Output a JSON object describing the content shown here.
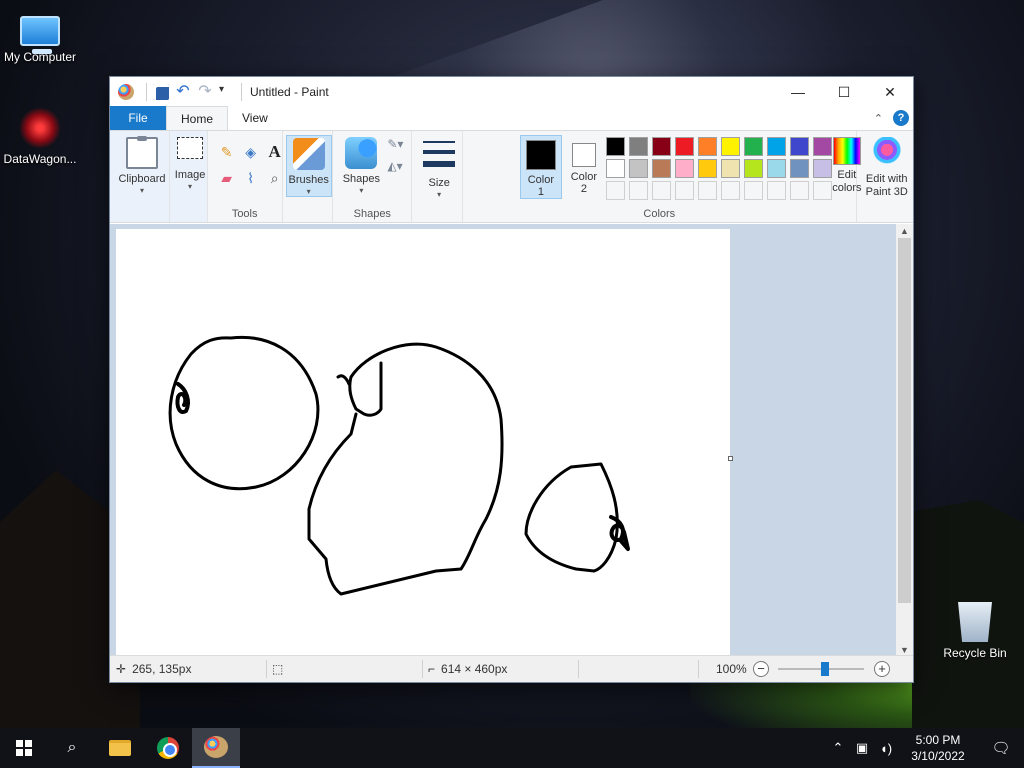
{
  "desktop": {
    "icons": [
      {
        "label": "My Computer",
        "icon": "monitor-icon"
      },
      {
        "label": "DataWagon...",
        "icon": "datawagon-icon"
      },
      {
        "label": "Recycle Bin",
        "icon": "recycle-bin-icon"
      }
    ]
  },
  "window": {
    "title": "Untitled - Paint",
    "controls": {
      "minimize": "—",
      "maximize": "☐",
      "close": "✕"
    }
  },
  "tabs": [
    {
      "label": "File"
    },
    {
      "label": "Home"
    },
    {
      "label": "View"
    }
  ],
  "ribbon": {
    "clipboard": {
      "label": "Clipboard"
    },
    "image": {
      "label": "Image"
    },
    "tools": {
      "label": "Tools"
    },
    "brushes": {
      "label": "Brushes"
    },
    "shapes": {
      "label": "Shapes",
      "group_label": "Shapes"
    },
    "size": {
      "label": "Size"
    },
    "color1": {
      "label": "Color",
      "num": "1",
      "value": "#000000"
    },
    "color2": {
      "label": "Color",
      "num": "2",
      "value": "#ffffff"
    },
    "colors_group": "Colors",
    "edit_colors": {
      "line1": "Edit",
      "line2": "colors"
    },
    "paint3d": {
      "line1": "Edit with",
      "line2": "Paint 3D"
    },
    "palette": [
      [
        "#000000",
        "#7f7f7f",
        "#880015",
        "#ed1c24",
        "#ff7f27",
        "#fff200",
        "#22b14c",
        "#00a2e8",
        "#3f48cc",
        "#a349a4"
      ],
      [
        "#ffffff",
        "#c3c3c3",
        "#b97a57",
        "#ffaec9",
        "#ffc90e",
        "#efe4b0",
        "#b5e61d",
        "#99d9ea",
        "#7092be",
        "#c8bfe7"
      ],
      [
        "#f5f6f7",
        "#f5f6f7",
        "#f5f6f7",
        "#f5f6f7",
        "#f5f6f7",
        "#f5f6f7",
        "#f5f6f7",
        "#f5f6f7",
        "#f5f6f7",
        "#f5f6f7"
      ]
    ]
  },
  "status": {
    "cursor_pos": "265, 135px",
    "canvas_size": "614 × 460px",
    "zoom": "100%",
    "zoom_level": 0.55
  },
  "taskbar": {
    "time": "5:00 PM",
    "date": "3/10/2022"
  }
}
